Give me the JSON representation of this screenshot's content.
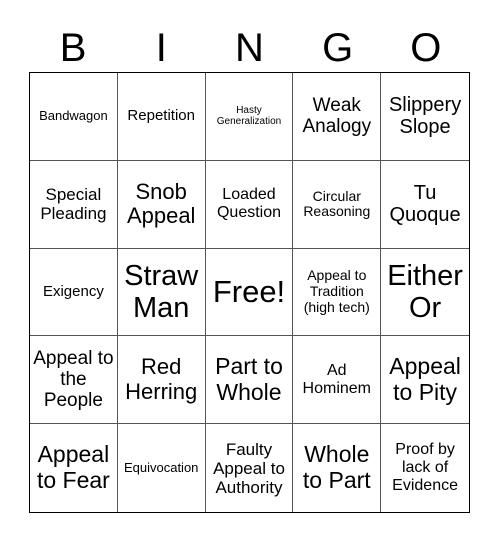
{
  "header": {
    "letters": [
      "B",
      "I",
      "N",
      "G",
      "O"
    ]
  },
  "board": {
    "rows": [
      [
        "Bandwagon",
        "Repetition",
        "Hasty Generalization",
        "Weak Analogy",
        "Slippery Slope"
      ],
      [
        "Special Pleading",
        "Snob Appeal",
        "Loaded Question",
        "Circular Reasoning",
        "Tu Quoque"
      ],
      [
        "Exigency",
        "Straw Man",
        "Free!",
        "Appeal to Tradition (high tech)",
        "Either Or"
      ],
      [
        "Appeal to the People",
        "Red Herring",
        "Part to Whole",
        "Ad Hominem",
        "Appeal to Pity"
      ],
      [
        "Appeal to Fear",
        "Equivocation",
        "Faulty Appeal to Authority",
        "Whole to Part",
        "Proof by lack of Evidence"
      ]
    ]
  },
  "colors": {
    "grid_line": "#555555",
    "border": "#000000",
    "text": "#000000",
    "background": "#ffffff"
  }
}
